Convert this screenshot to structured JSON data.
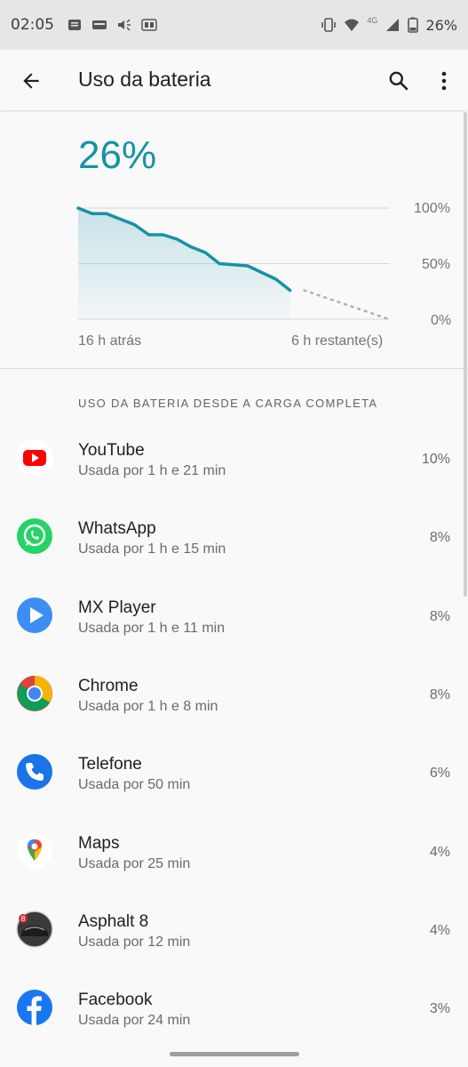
{
  "status_bar": {
    "time": "02:05",
    "battery_text": "26%",
    "network_label": "4G"
  },
  "app_bar": {
    "title": "Uso da bateria"
  },
  "battery": {
    "level_text": "26%",
    "level_percent": 26,
    "accent_color": "#1592a8"
  },
  "chart_data": {
    "type": "area",
    "x_labels": [
      "16 h atrás",
      "6 h restante(s)"
    ],
    "y_ticks": [
      "100%",
      "50%",
      "0%"
    ],
    "ylim": [
      0,
      100
    ],
    "x": [
      0,
      1,
      2,
      3,
      4,
      5,
      6,
      7,
      8,
      9,
      10,
      11,
      12,
      13,
      14,
      15,
      16
    ],
    "values": [
      100,
      95,
      95,
      90,
      85,
      76,
      76,
      72,
      65,
      60,
      50,
      49,
      48,
      42,
      36,
      26
    ],
    "projection": {
      "from_x": 16,
      "to_x": 22,
      "from_value": 26,
      "to_value": 0
    },
    "grid": true
  },
  "section": {
    "header": "USO DA BATERIA DESDE A CARGA COMPLETA"
  },
  "apps": [
    {
      "name": "YouTube",
      "usage": "Usada por 1 h e 21 min",
      "percent": "10%",
      "icon": "youtube-icon"
    },
    {
      "name": "WhatsApp",
      "usage": "Usada por 1 h e 15 min",
      "percent": "8%",
      "icon": "whatsapp-icon"
    },
    {
      "name": "MX Player",
      "usage": "Usada por 1 h e 11 min",
      "percent": "8%",
      "icon": "mx-player-icon"
    },
    {
      "name": "Chrome",
      "usage": "Usada por 1 h e 8 min",
      "percent": "8%",
      "icon": "chrome-icon"
    },
    {
      "name": "Telefone",
      "usage": "Usada por 50 min",
      "percent": "6%",
      "icon": "phone-icon"
    },
    {
      "name": "Maps",
      "usage": "Usada por 25 min",
      "percent": "4%",
      "icon": "maps-icon"
    },
    {
      "name": "Asphalt 8",
      "usage": "Usada por 12 min",
      "percent": "4%",
      "icon": "asphalt-icon"
    },
    {
      "name": "Facebook",
      "usage": "Usada por 24 min",
      "percent": "3%",
      "icon": "facebook-icon"
    }
  ]
}
